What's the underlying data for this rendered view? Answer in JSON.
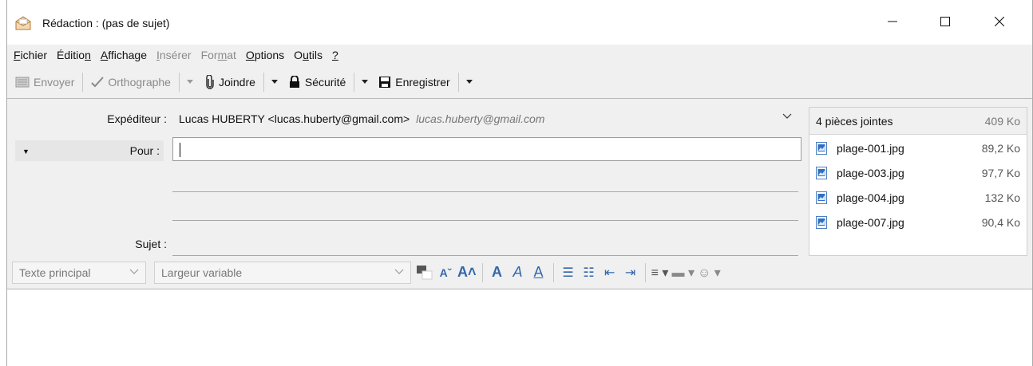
{
  "window": {
    "title": "Rédaction : (pas de sujet)",
    "controls": {
      "minimize": "—",
      "maximize": "☐",
      "close": "✕"
    }
  },
  "menu": {
    "items": [
      {
        "label": "Fichier",
        "accel": "F",
        "disabled": false
      },
      {
        "label": "Édition",
        "accel": "n",
        "disabled": false
      },
      {
        "label": "Affichage",
        "accel": "A",
        "disabled": false
      },
      {
        "label": "Insérer",
        "accel": "I",
        "disabled": true
      },
      {
        "label": "Format",
        "accel": "m",
        "disabled": true
      },
      {
        "label": "Options",
        "accel": "O",
        "disabled": false
      },
      {
        "label": "Outils",
        "accel": "u",
        "disabled": false
      },
      {
        "label": "?",
        "accel": "?",
        "disabled": false
      }
    ]
  },
  "toolbar": {
    "send_label": "Envoyer",
    "spelling_label": "Orthographe",
    "attach_label": "Joindre",
    "security_label": "Sécurité",
    "save_label": "Enregistrer"
  },
  "header": {
    "from_label": "Expéditeur :",
    "from_value": "Lucas HUBERTY <lucas.huberty@gmail.com>",
    "from_alias": "lucas.huberty@gmail.com",
    "to_label": "Pour :",
    "to_value": "",
    "subject_label": "Sujet :",
    "subject_value": ""
  },
  "attachments": {
    "summary": "4 pièces jointes",
    "total_size": "409 Ko",
    "files": [
      {
        "name": "plage-001.jpg",
        "size": "89,2 Ko"
      },
      {
        "name": "plage-003.jpg",
        "size": "97,7 Ko"
      },
      {
        "name": "plage-004.jpg",
        "size": "132 Ko"
      },
      {
        "name": "plage-007.jpg",
        "size": "90,4 Ko"
      }
    ]
  },
  "format": {
    "paragraph_style": "Texte principal",
    "font": "Largeur variable"
  },
  "colors": {
    "chrome_bg": "#f0f0f0",
    "icon_blue": "#3366aa",
    "disabled_text": "#8a8a8a"
  }
}
